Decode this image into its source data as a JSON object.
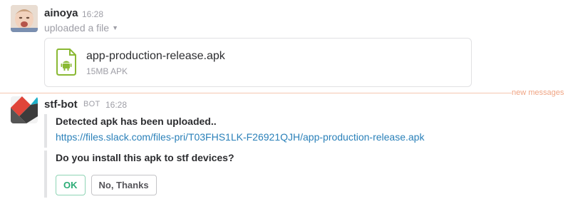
{
  "messages": [
    {
      "sender": "ainoya",
      "time": "16:28",
      "subline": "uploaded a file",
      "caret_icon": "caret-down-icon",
      "file": {
        "name": "app-production-release.apk",
        "meta": "15MB APK",
        "icon": "android-file-icon",
        "icon_color": "#8ab934"
      }
    },
    {
      "sender": "stf-bot",
      "bot_tag": "BOT",
      "time": "16:28",
      "attachments": [
        {
          "title": "Detected apk has been uploaded..",
          "link": "https://files.slack.com/files-pri/T03FHS1LK-F26921QJH/app-production-release.apk"
        },
        {
          "title": "Do you install this apk to stf devices?",
          "buttons": [
            "OK",
            "No, Thanks"
          ]
        }
      ]
    }
  ],
  "divider": {
    "label": "new messages",
    "color": "#f0a584"
  },
  "colors": {
    "link": "#2a80b9",
    "ok_button": "#2bac76",
    "attachment_bar": "#e3e4e6"
  }
}
